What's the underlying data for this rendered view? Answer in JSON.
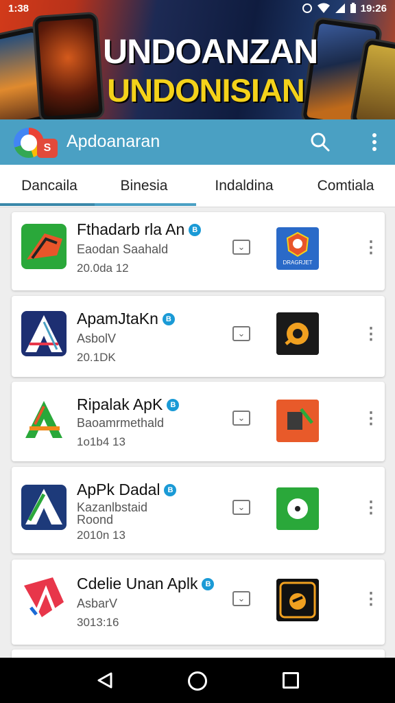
{
  "status_bar": {
    "time_left": "1:38",
    "time_right": "19:26",
    "icons": [
      "alarm-icon",
      "wifi-icon",
      "signal-icon",
      "battery-icon"
    ]
  },
  "banner": {
    "line1": "UNDOANZAN",
    "line2": "UNDONISIAN"
  },
  "app_bar": {
    "logo_badge": "S",
    "title": "Apdoanaran",
    "icons": [
      "search-icon",
      "more-vert-icon"
    ]
  },
  "tabs": [
    {
      "label": "Dancaila"
    },
    {
      "label": "Binesia"
    },
    {
      "label": "Indaldina"
    },
    {
      "label": "Comtiala"
    }
  ],
  "selected_tab": "Dancaila",
  "apps": [
    {
      "name": "Fthadarb rla An",
      "subtitle": "Eaodan Saahald",
      "date": "20.0da 12",
      "verified": "B"
    },
    {
      "name": "ApamJtaKn",
      "subtitle": "AsbolV",
      "date": "20.1DK",
      "verified": "B"
    },
    {
      "name": "Ripalak ApK",
      "subtitle": "Baoamrmethald",
      "date": "1o1b4 13",
      "verified": "B"
    },
    {
      "name": "ApPk Dadal",
      "subtitle": "Kazanlbstaid Roond",
      "date": "2010n 13",
      "verified": "B"
    },
    {
      "name": "Cdelie Unan Aplk",
      "subtitle": "AsbarV",
      "date": "3013:16",
      "verified": "B"
    }
  ],
  "icon_glyphs": {
    "download": "⌄",
    "more": "⋮"
  },
  "thumb_labels": {
    "first": "DRAGRJET"
  },
  "colors": {
    "app_bar": "#4aa0c3",
    "tab_indicator": "#4aa0c3",
    "verified": "#1a9ad6",
    "banner_yellow": "#f4d21a"
  }
}
